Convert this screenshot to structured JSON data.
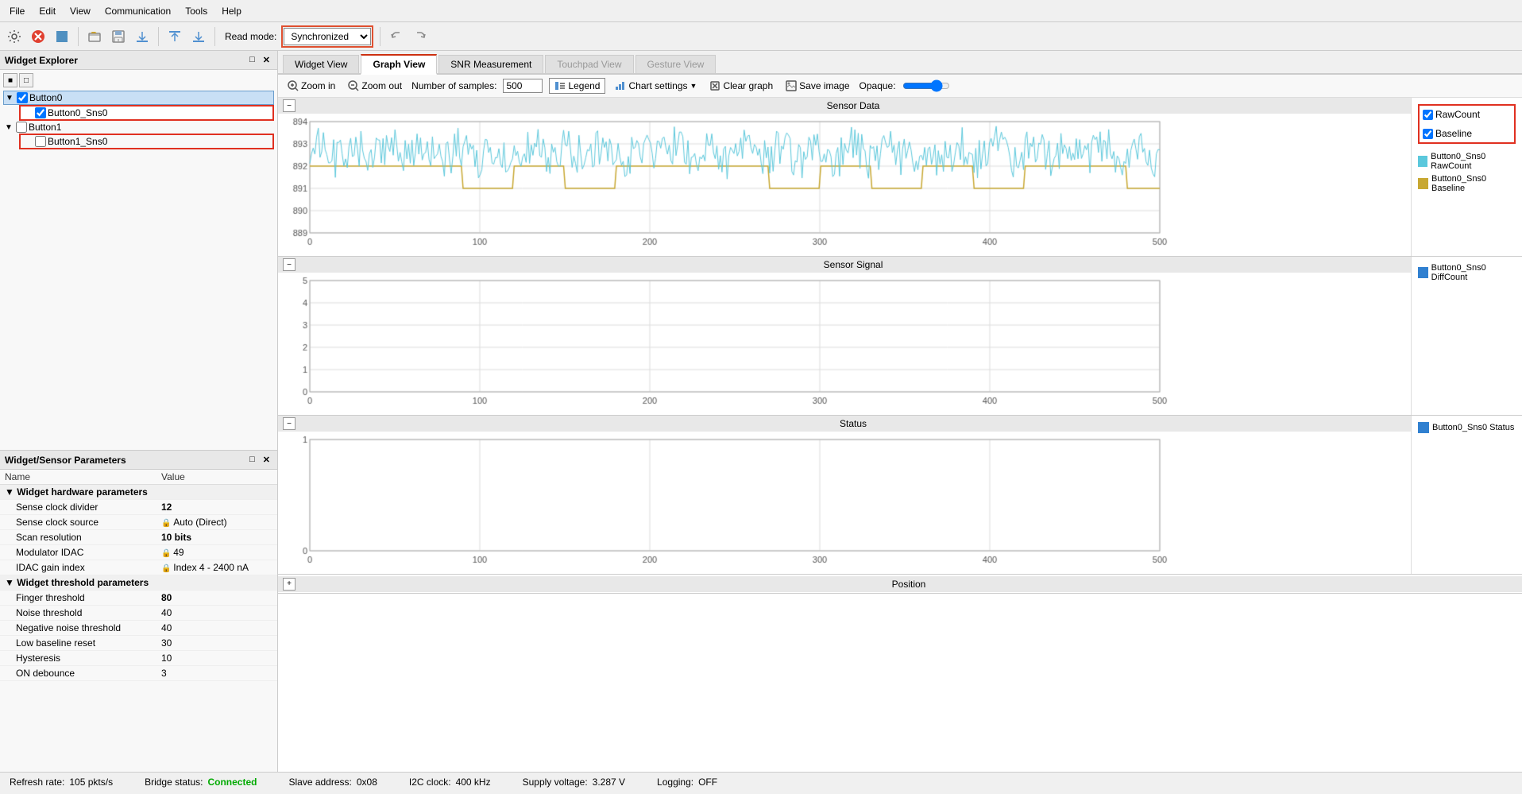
{
  "menubar": {
    "items": [
      "File",
      "Edit",
      "View",
      "Communication",
      "Tools",
      "Help"
    ]
  },
  "toolbar": {
    "read_mode_label": "Read mode:",
    "read_mode_value": "Synchronized",
    "undo_label": "Undo",
    "redo_label": "Redo"
  },
  "left_panel": {
    "widget_explorer_title": "Widget Explorer",
    "we_toolbar_icons": [
      "icon1",
      "icon2"
    ],
    "tree": [
      {
        "id": "Button0",
        "label": "Button0",
        "checked": true,
        "expanded": true,
        "children": [
          {
            "id": "Button0_Sns0",
            "label": "Button0_Sns0",
            "checked": true
          }
        ]
      },
      {
        "id": "Button1",
        "label": "Button1",
        "checked": false,
        "expanded": true,
        "children": [
          {
            "id": "Button1_Sns0",
            "label": "Button1_Sns0",
            "checked": false
          }
        ]
      }
    ],
    "params_title": "Widget/Sensor Parameters",
    "params_headers": [
      "Name",
      "Value"
    ],
    "params_sections": [
      {
        "section": "Widget hardware parameters",
        "rows": [
          {
            "name": "Sense clock divider",
            "value": "12",
            "bold": true
          },
          {
            "name": "Sense clock source",
            "value": "Auto (Direct)",
            "icon": "lock"
          },
          {
            "name": "Scan resolution",
            "value": "10 bits",
            "bold": true
          },
          {
            "name": "Modulator IDAC",
            "value": "49",
            "icon": "lock"
          },
          {
            "name": "IDAC gain index",
            "value": "Index 4 - 2400 nA",
            "icon": "lock"
          }
        ]
      },
      {
        "section": "Widget threshold parameters",
        "rows": [
          {
            "name": "Finger threshold",
            "value": "80",
            "bold": true
          },
          {
            "name": "Noise threshold",
            "value": "40",
            "bold": false
          },
          {
            "name": "Negative noise threshold",
            "value": "40",
            "bold": false
          },
          {
            "name": "Low baseline reset",
            "value": "30",
            "bold": false
          },
          {
            "name": "Hysteresis",
            "value": "10",
            "bold": false
          },
          {
            "name": "ON debounce",
            "value": "3",
            "bold": false
          }
        ]
      }
    ]
  },
  "tabs": [
    {
      "label": "Widget View",
      "active": false,
      "disabled": false
    },
    {
      "label": "Graph View",
      "active": true,
      "disabled": false
    },
    {
      "label": "SNR Measurement",
      "active": false,
      "disabled": false
    },
    {
      "label": "Touchpad View",
      "active": false,
      "disabled": false
    },
    {
      "label": "Gesture View",
      "active": false,
      "disabled": false
    }
  ],
  "graph_toolbar": {
    "zoom_in": "Zoom in",
    "zoom_out": "Zoom out",
    "num_samples_label": "Number of samples:",
    "num_samples_value": "500",
    "legend_label": "Legend",
    "chart_settings_label": "Chart settings",
    "clear_graph_label": "Clear graph",
    "save_image_label": "Save image",
    "opaque_label": "Opaque:"
  },
  "charts": [
    {
      "id": "sensor_data",
      "title": "Sensor Data",
      "y_range": [
        889,
        894
      ],
      "y_ticks": [
        889,
        890,
        891,
        892,
        893,
        894
      ],
      "x_ticks": [
        0,
        100,
        200,
        300,
        400,
        500
      ],
      "legend_checkboxes": [
        {
          "label": "RawCount",
          "checked": true
        },
        {
          "label": "Baseline",
          "checked": true
        }
      ],
      "legend_items": [
        {
          "label": "Button0_Sns0 RawCount",
          "color": "#5bc8dc"
        },
        {
          "label": "Button0_Sns0 Baseline",
          "color": "#c8a832"
        }
      ]
    },
    {
      "id": "sensor_signal",
      "title": "Sensor Signal",
      "y_range": [
        0,
        5
      ],
      "y_ticks": [
        0,
        1,
        2,
        3,
        4,
        5
      ],
      "x_ticks": [
        0,
        100,
        200,
        300,
        400,
        500
      ],
      "legend_items": [
        {
          "label": "Button0_Sns0 DiffCount",
          "color": "#3080d0"
        }
      ]
    },
    {
      "id": "status",
      "title": "Status",
      "y_range": [
        0,
        1
      ],
      "y_ticks": [
        0,
        1
      ],
      "x_ticks": [
        0,
        100,
        200,
        300,
        400,
        500
      ],
      "legend_items": [
        {
          "label": "Button0_Sns0 Status",
          "color": "#3080d0"
        }
      ]
    },
    {
      "id": "position",
      "title": "Position",
      "collapsed": true
    }
  ],
  "status_bar": {
    "refresh_rate_label": "Refresh rate:",
    "refresh_rate_value": "105 pkts/s",
    "bridge_status_label": "Bridge status:",
    "bridge_status_value": "Connected",
    "slave_address_label": "Slave address:",
    "slave_address_value": "0x08",
    "i2c_clock_label": "I2C clock:",
    "i2c_clock_value": "400 kHz",
    "supply_voltage_label": "Supply voltage:",
    "supply_voltage_value": "3.287 V",
    "logging_label": "Logging:",
    "logging_value": "OFF"
  }
}
